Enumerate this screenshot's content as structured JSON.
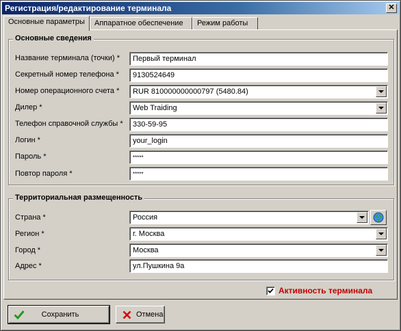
{
  "window": {
    "title": "Регистрация/редактирование терминала",
    "close_label": "✕"
  },
  "tabs": [
    {
      "label": "Основные параметры"
    },
    {
      "label": "Аппаратное обеспечение"
    },
    {
      "label": "Режим работы"
    }
  ],
  "main_group": {
    "title": "Основные сведения",
    "fields": [
      {
        "label": "Название терминала (точки) *",
        "value": "Первый терминал"
      },
      {
        "label": "Секретный номер телефона *",
        "value": "9130524649"
      },
      {
        "label": "Номер операционного счета *",
        "value": "RUR 810000000000797 (5480.84)"
      },
      {
        "label": "Дилер *",
        "value": "Web Traiding"
      },
      {
        "label": "Телефон справочной службы *",
        "value": "330-59-95"
      },
      {
        "label": "Логин *",
        "value": "your_login"
      },
      {
        "label": "Пароль *",
        "value": "*****"
      },
      {
        "label": "Повтор пароля *",
        "value": "*****"
      }
    ]
  },
  "location_group": {
    "title": "Территориальная размещенность",
    "fields": [
      {
        "label": "Страна *",
        "value": "Россия"
      },
      {
        "label": "Регион *",
        "value": "г. Москва"
      },
      {
        "label": "Город *",
        "value": "Москва"
      },
      {
        "label": "Адрес *",
        "value": "ул.Пушкина 9а"
      }
    ]
  },
  "active_checkbox": {
    "label": "Активность терминала",
    "checked": true
  },
  "buttons": {
    "save_label": "Сохранить",
    "cancel_label": "Отмена"
  },
  "colors": {
    "titlebar": "#0a246a",
    "accent_red": "#c00000",
    "face": "#d4d0c8"
  }
}
